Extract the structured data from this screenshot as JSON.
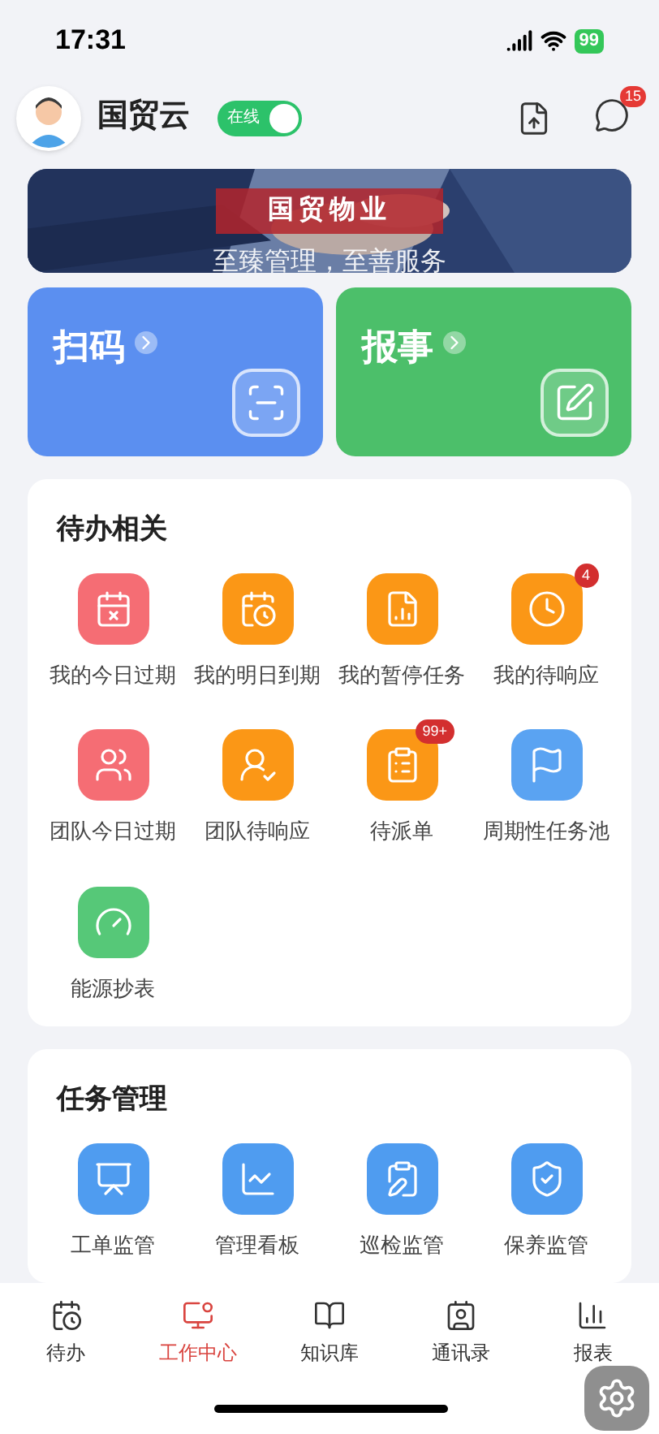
{
  "status_bar": {
    "time": "17:31",
    "battery": "99"
  },
  "header": {
    "name": "国贸云",
    "status_toggle": {
      "label": "在线",
      "on": true
    },
    "message_badge": "15"
  },
  "banner": {
    "kind": "picture",
    "title": "国贸物业",
    "subtitle": "至臻管理，至善服务"
  },
  "quick_actions": [
    {
      "label": "扫码",
      "kind": "scan",
      "color": "#5b8ff0"
    },
    {
      "label": "报事",
      "kind": "report",
      "color": "#4cbf6a"
    }
  ],
  "sections": [
    {
      "title": "待办相关",
      "items": [
        {
          "label": "我的今日过期",
          "kind": "today",
          "color": "#f56d74"
        },
        {
          "label": "我的明日到期",
          "kind": "tomorrow",
          "color": "#fb9716"
        },
        {
          "label": "我的暂停任务",
          "kind": "paused",
          "color": "#fb9716"
        },
        {
          "label": "我的待响应",
          "kind": "respond",
          "color": "#fb9716",
          "badge": "4"
        },
        {
          "label": "团队今日过期",
          "kind": "team-overdue",
          "color": "#f56d74"
        },
        {
          "label": "团队待响应",
          "kind": "team-respond",
          "color": "#fb9716"
        },
        {
          "label": "待派单",
          "kind": "dispatch",
          "color": "#fb9716",
          "badge": "99+"
        },
        {
          "label": "周期性任务池",
          "kind": "periodic",
          "color": "#5aa3f2"
        },
        {
          "label": "能源抄表",
          "kind": "energy",
          "color": "#56c878"
        }
      ]
    },
    {
      "title": "任务管理",
      "items": [
        {
          "label": "工单监管",
          "kind": "workorder",
          "color": "#4f9cf0"
        },
        {
          "label": "管理看板",
          "kind": "board",
          "color": "#4f9cf0"
        },
        {
          "label": "巡检监管",
          "kind": "patrol",
          "color": "#4f9cf0"
        },
        {
          "label": "保养监管",
          "kind": "maintenance",
          "color": "#4f9cf0"
        }
      ]
    }
  ],
  "tabs": [
    {
      "label": "待办",
      "kind": "todo",
      "selected": false
    },
    {
      "label": "工作中心",
      "kind": "work",
      "selected": true
    },
    {
      "label": "知识库",
      "kind": "knowledge",
      "selected": false
    },
    {
      "label": "通讯录",
      "kind": "contacts",
      "selected": false
    },
    {
      "label": "报表",
      "kind": "reports",
      "selected": false
    }
  ]
}
